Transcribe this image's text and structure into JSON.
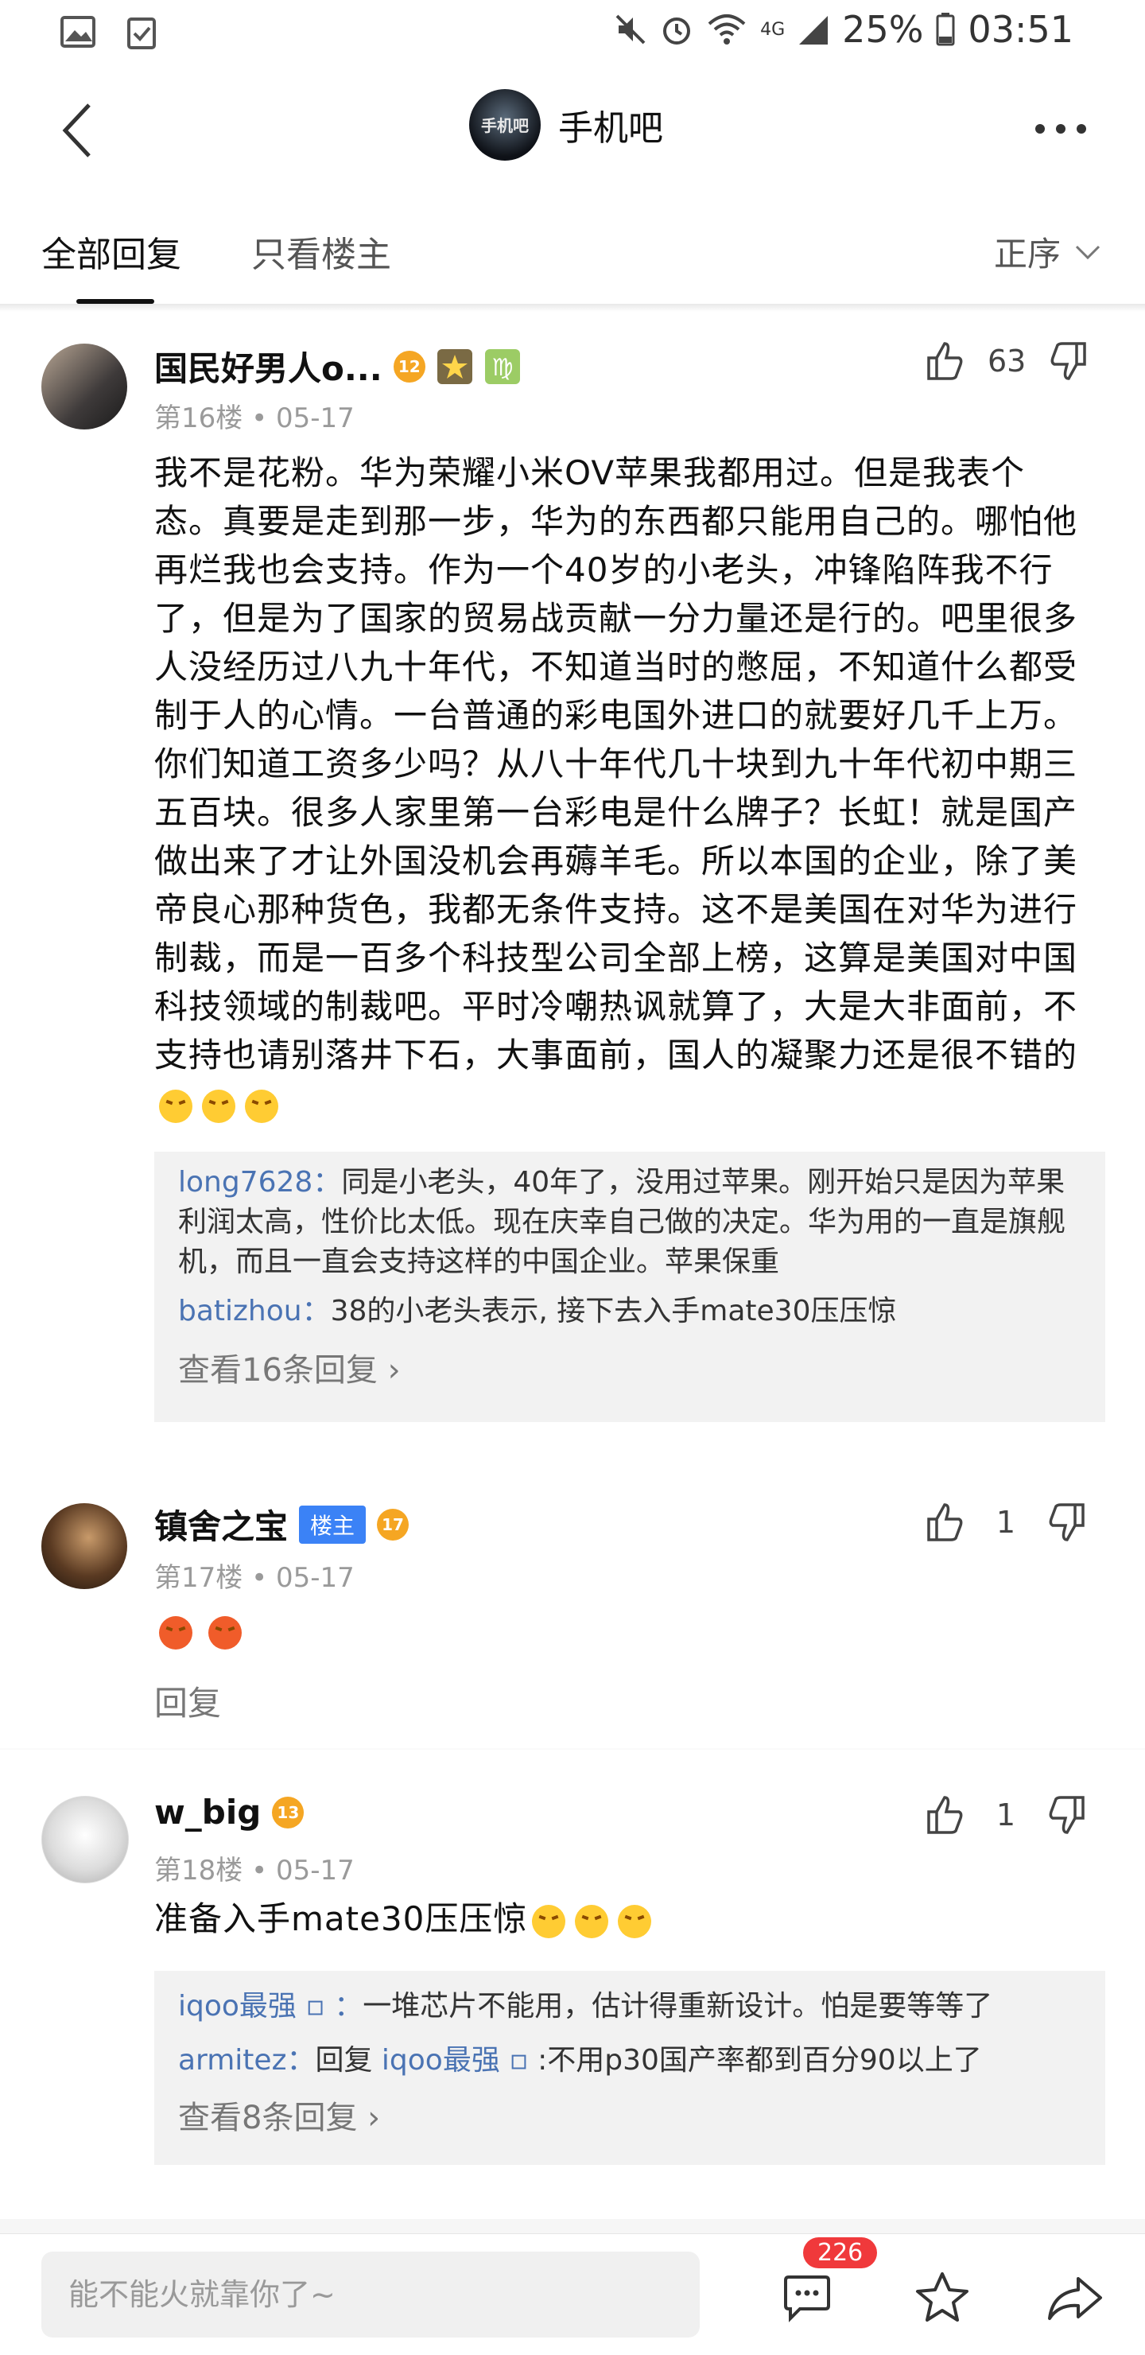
{
  "status_bar": {
    "battery": "25%",
    "time": "03:51",
    "network": "4G"
  },
  "nav": {
    "title": "手机吧",
    "avatar_text": "手机吧"
  },
  "tabs": {
    "all": "全部回复",
    "owner_only": "只看楼主",
    "sort": "正序"
  },
  "posts": [
    {
      "username": "国民好男人o...",
      "level": "12",
      "floor": "第16楼",
      "date": "05-17",
      "likes": "63",
      "text": "我不是花粉。华为荣耀小米OV苹果我都用过。但是我表个态。真要是走到那一步，华为的东西都只能用自己的。哪怕他再烂我也会支持。作为一个40岁的小老头，冲锋陷阵我不行了，但是为了国家的贸易战贡献一分力量还是行的。吧里很多人没经历过八九十年代，不知道当时的憋屈，不知道什么都受制于人的心情。一台普通的彩电国外进口的就要好几千上万。你们知道工资多少吗？从八十年代几十块到九十年代初中期三五百块。很多人家里第一台彩电是什么牌子？长虹！就是国产做出来了才让外国没机会再薅羊毛。所以本国的企业，除了美帝良心那种货色，我都无条件支持。这不是美国在对华为进行制裁，而是一百多个科技型公司全部上榜，这算是美国对中国科技领域的制裁吧。平时冷嘲热讽就算了，大是大非面前，不支持也请别落井下石，大事面前，国人的凝聚力还是很不错的",
      "replies": [
        {
          "user": "long7628：",
          "text": "同是小老头，40年了，没用过苹果。刚开始只是因为苹果利润太高，性价比太低。现在庆幸自己做的决定。华为用的一直是旗舰机，而且一直会支持这样的中国企业。苹果保重"
        },
        {
          "user": "batizhou：",
          "text": "38的小老头表示, 接下去入手mate30压压惊"
        }
      ],
      "more": "查看16条回复 ›"
    },
    {
      "username": "镇舍之宝",
      "owner_tag": "楼主",
      "level": "17",
      "floor": "第17楼",
      "date": "05-17",
      "likes": "1",
      "reply_label": "回复"
    },
    {
      "username": "w_big",
      "level": "13",
      "floor": "第18楼",
      "date": "05-17",
      "likes": "1",
      "text": "准备入手mate30压压惊",
      "replies": [
        {
          "user": "iqoo最强 ▫ ：",
          "text": "一堆芯片不能用，估计得重新设计。怕是要等等了"
        },
        {
          "user": "armitez：",
          "prefix": "回复 ",
          "user2": "iqoo最强 ▫",
          "text": "  :不用p30国产率都到百分90以上了"
        }
      ],
      "more": "查看8条回复 ›"
    }
  ],
  "bottom_bar": {
    "placeholder": "能不能火就靠你了~",
    "comment_count": "226"
  },
  "colors": {
    "link": "#4a73b3",
    "badge_red": "#f0393b",
    "owner_tag": "#3b82f6",
    "level_badge": "#f5a623"
  }
}
